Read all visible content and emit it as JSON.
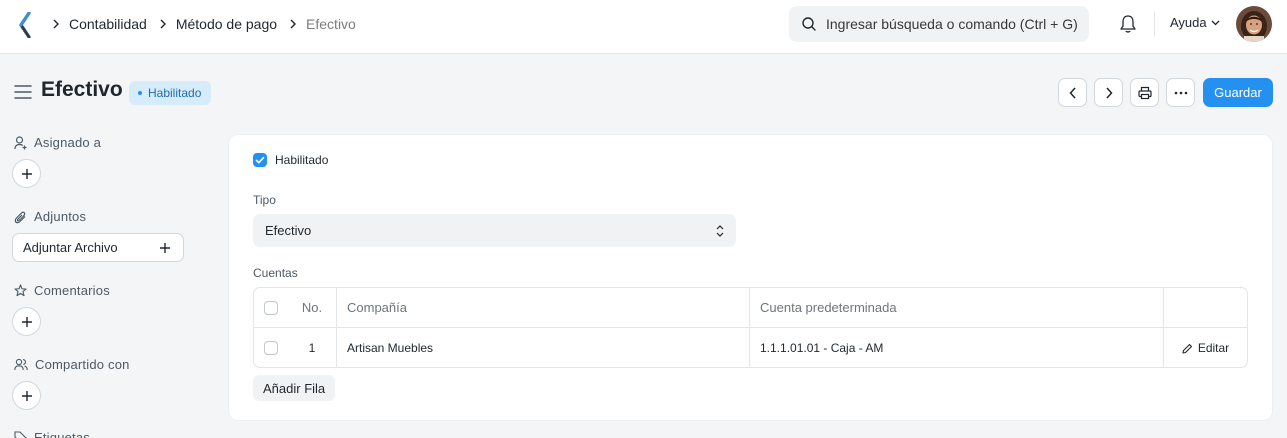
{
  "breadcrumbs": [
    "Contabilidad",
    "Método de pago",
    "Efectivo"
  ],
  "search": {
    "placeholder": "Ingresar búsqueda o comando (Ctrl + G)"
  },
  "navbar": {
    "help_label": "Ayuda"
  },
  "page": {
    "title": "Efectivo",
    "status": "Habilitado",
    "save_label": "Guardar"
  },
  "sidebar": {
    "assigned_label": "Asignado a",
    "attachments_label": "Adjuntos",
    "attach_button": "Adjuntar Archivo",
    "comments_label": "Comentarios",
    "shared_label": "Compartido con",
    "tags_label": "Etiquetas"
  },
  "form": {
    "enabled_label": "Habilitado",
    "enabled_checked": true,
    "type_label": "Tipo",
    "type_value": "Efectivo",
    "accounts_label": "Cuentas",
    "table": {
      "headers": [
        "No.",
        "Compañía",
        "Cuenta predeterminada"
      ],
      "rows": [
        {
          "no": "1",
          "company": "Artisan Muebles",
          "account": "1.1.1.01.01 - Caja - AM",
          "action": "Editar"
        }
      ]
    },
    "add_row_label": "Añadir Fila"
  },
  "colors": {
    "primary": "#2490ef",
    "badge_bg": "#d6ecfb",
    "badge_text": "#1f6cb0"
  }
}
